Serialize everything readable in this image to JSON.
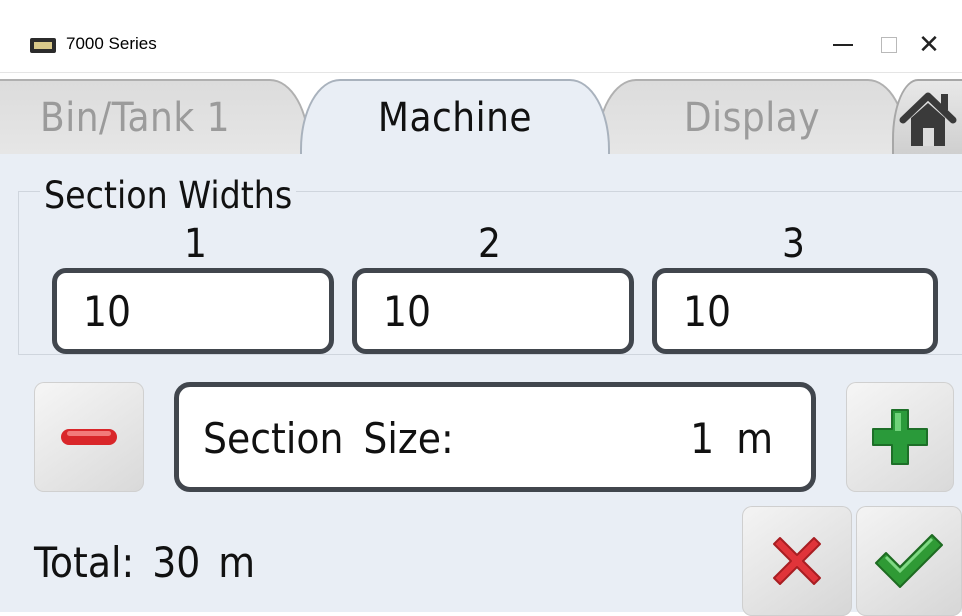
{
  "window": {
    "title": "7000 Series",
    "icon": "device-icon",
    "controls": [
      "minimize-icon",
      "maximize-icon",
      "close-icon"
    ],
    "close_glyph": "✕"
  },
  "tabs": [
    {
      "label": "Bin/Tank 1",
      "active": false
    },
    {
      "label": "Machine",
      "active": true
    },
    {
      "label": "Display",
      "active": false
    }
  ],
  "home_button": {
    "icon": "home-icon"
  },
  "section_widths": {
    "title": "Section Widths",
    "columns": [
      {
        "number": "1",
        "value": "10"
      },
      {
        "number": "2",
        "value": "10"
      },
      {
        "number": "3",
        "value": "10"
      }
    ]
  },
  "section_size": {
    "label": "Section Size:",
    "value": "1 m",
    "decrease_icon": "minus-icon",
    "increase_icon": "plus-icon"
  },
  "total": {
    "text": "Total: 30 m"
  },
  "actions": {
    "cancel_icon": "cancel-x-icon",
    "confirm_icon": "confirm-check-icon"
  },
  "colors": {
    "panel_bg": "#e9eef5",
    "field_border": "#41464d",
    "minus_red": "#d9262a",
    "plus_green": "#2a9a3a",
    "cancel_red": "#e0343a",
    "confirm_green": "#2f9a35"
  }
}
